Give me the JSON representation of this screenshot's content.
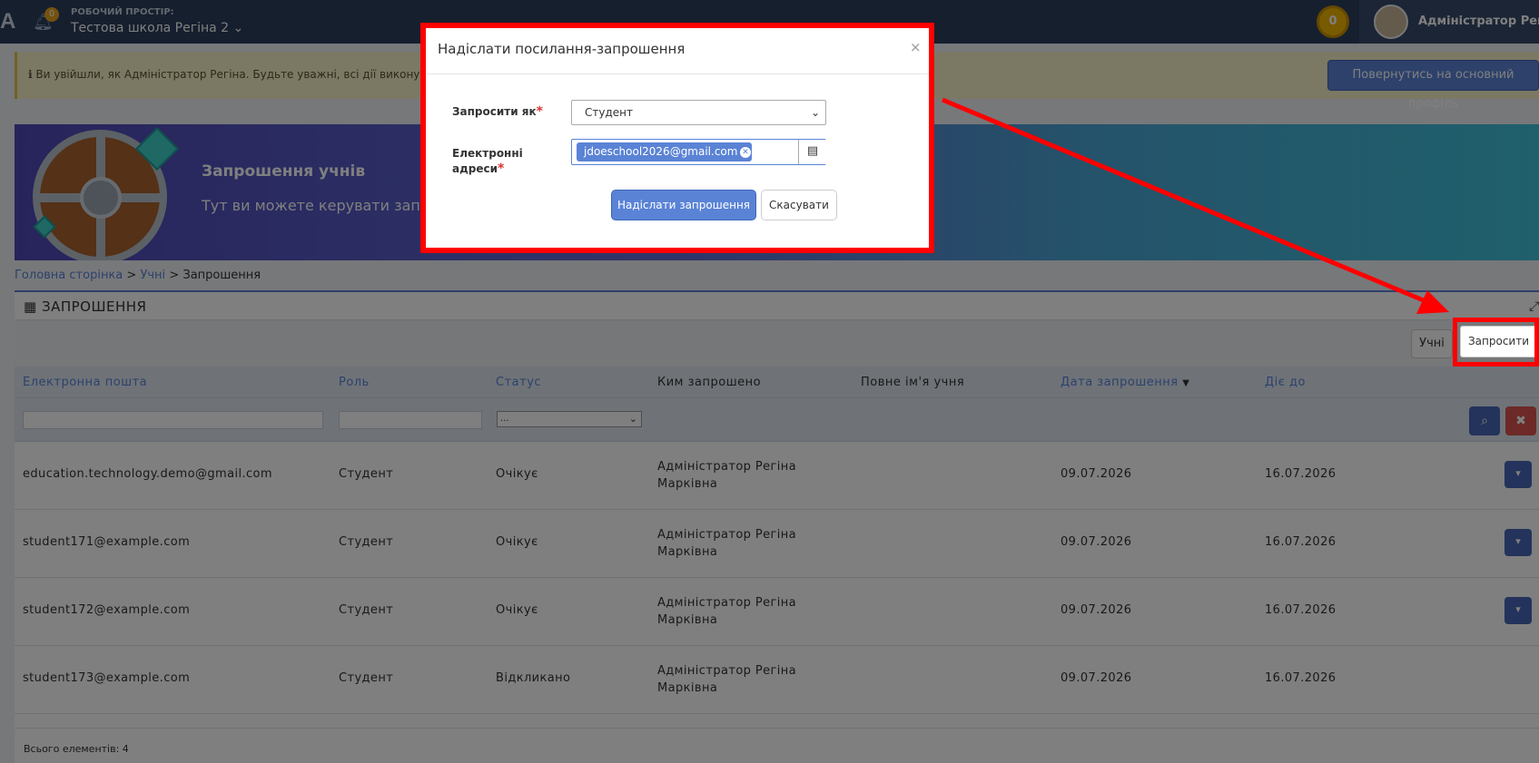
{
  "topbar": {
    "logo": "A",
    "notif_count": "0",
    "workspace_label": "РОБОЧИЙ ПРОСТІР:",
    "workspace_name": "Тестова школа Регіна 2",
    "coins": "0",
    "user_name": "Адміністратор Регіна"
  },
  "infobar": {
    "text": "ℹ Ви увійшли, як Адміністратор Регіна. Будьте уважні, всі дії виконуються",
    "return_button": "Повернутись на основний профіль"
  },
  "hero": {
    "title": "Запрошення учнів",
    "subtitle": "Тут ви можете керувати запрошеннями"
  },
  "breadcrumb": {
    "home": "Головна сторінка",
    "students": "Учні",
    "sep": ">",
    "current": "Запрошення"
  },
  "panel": {
    "title": "ЗАПРОШЕННЯ",
    "students_button": "Учні",
    "invite_button": "Запросити"
  },
  "table": {
    "columns": [
      "Електронна пошта",
      "Роль",
      "Статус",
      "Ким запрошено",
      "Повне ім'я учня",
      "Дата запрошення",
      "Діє до"
    ],
    "status_filter": "...",
    "rows": [
      {
        "email": "education.technology.demo@gmail.com",
        "role": "Студент",
        "status": "Очікує",
        "invited_by_1": "Адміністратор Регіна",
        "invited_by_2": "Марківна",
        "full_name": "",
        "date": "09.07.2026",
        "valid_until": "16.07.2026"
      },
      {
        "email": "student171@example.com",
        "role": "Студент",
        "status": "Очікує",
        "invited_by_1": "Адміністратор Регіна",
        "invited_by_2": "Марківна",
        "full_name": "",
        "date": "09.07.2026",
        "valid_until": "16.07.2026"
      },
      {
        "email": "student172@example.com",
        "role": "Студент",
        "status": "Очікує",
        "invited_by_1": "Адміністратор Регіна",
        "invited_by_2": "Марківна",
        "full_name": "",
        "date": "09.07.2026",
        "valid_until": "16.07.2026"
      },
      {
        "email": "student173@example.com",
        "role": "Студент",
        "status": "Відкликано",
        "invited_by_1": "Адміністратор Регіна",
        "invited_by_2": "Марківна",
        "full_name": "",
        "date": "09.07.2026",
        "valid_until": "16.07.2026"
      }
    ],
    "total": "Всього елементів: 4"
  },
  "modal": {
    "title": "Надіслати посилання-запрошення",
    "close": "×",
    "invite_as_label": "Запросити як",
    "invite_as_value": "Студент",
    "emails_label_1": "Електронні",
    "emails_label_2": "адреси",
    "required_mark": "*",
    "email_tag": "jdoeschool2026@gmail.com",
    "send_button": "Надіслати запрошення",
    "cancel_button": "Скасувати"
  },
  "colors": {
    "primary": "#5a83d6",
    "highlight": "#ff0000",
    "topbar": "#2c3e5c"
  }
}
